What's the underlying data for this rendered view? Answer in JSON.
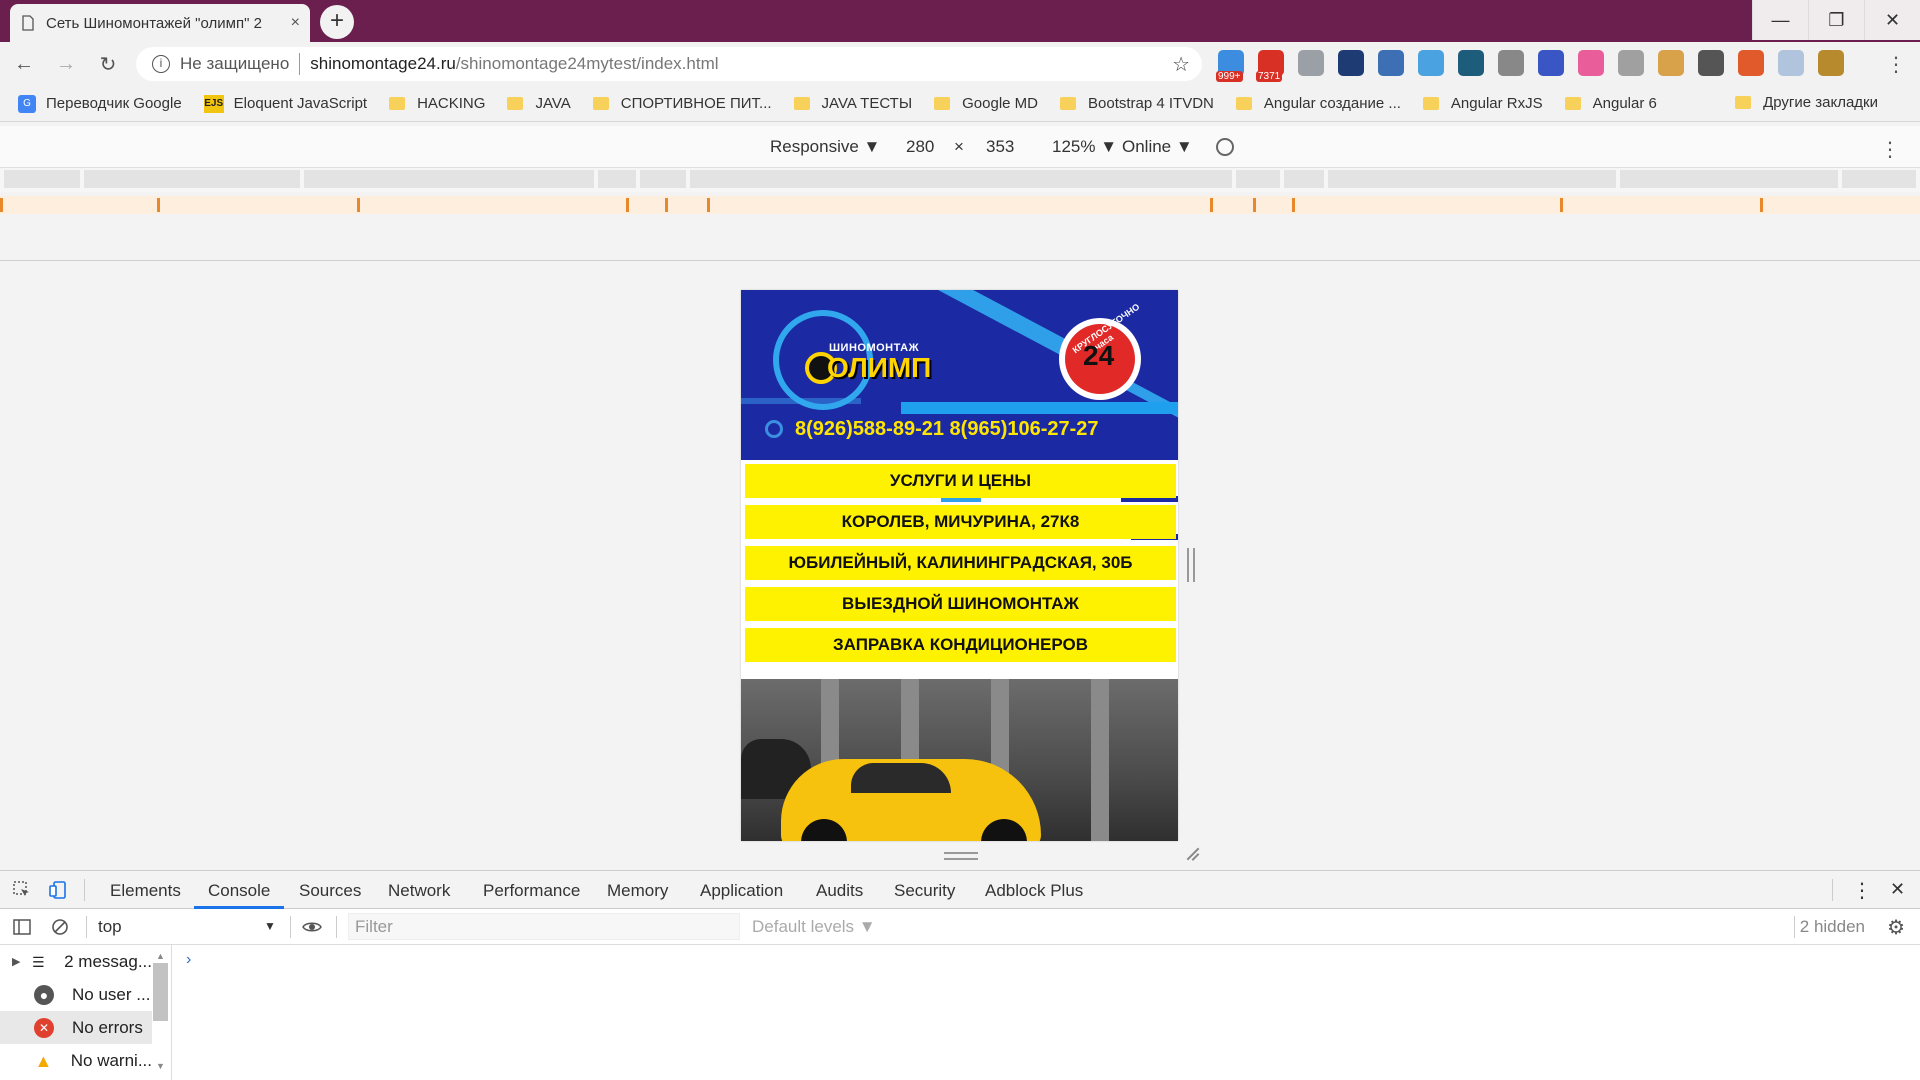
{
  "browser": {
    "tab_title": "Сеть Шиномонтажей \"олимп\" 2",
    "tab_close": "×",
    "new_tab": "+",
    "window": {
      "minimize": "—",
      "restore": "❐",
      "close": "✕"
    },
    "nav": {
      "back": "←",
      "forward": "→",
      "reload": "↻"
    },
    "address": {
      "security_label": "Не защищено",
      "host": "shinomontage24.ru",
      "path": "/shinomontage24mytest/index.html",
      "star": "☆"
    },
    "extensions": [
      {
        "name": "ext-1",
        "color": "#3c8de0",
        "badge": "999+"
      },
      {
        "name": "ext-gmail",
        "color": "#d93025",
        "badge": "7371"
      },
      {
        "name": "ext-music",
        "color": "#9aa0a6",
        "badge": ""
      },
      {
        "name": "ext-drive",
        "color": "#1f3b73",
        "badge": ""
      },
      {
        "name": "ext-wordpress",
        "color": "#3c6fb4",
        "badge": ""
      },
      {
        "name": "ext-search",
        "color": "#4aa3e0",
        "badge": ""
      },
      {
        "name": "ext-w",
        "color": "#1d5c7b",
        "badge": ""
      },
      {
        "name": "ext-gear",
        "color": "#888888",
        "badge": ""
      },
      {
        "name": "ext-crop",
        "color": "#3a55c4",
        "badge": ""
      },
      {
        "name": "ext-gradient",
        "color": "#e85d9a",
        "badge": ""
      },
      {
        "name": "ext-circle",
        "color": "#a0a0a0",
        "badge": ""
      },
      {
        "name": "ext-palette",
        "color": "#d8a24a",
        "badge": ""
      },
      {
        "name": "ext-download",
        "color": "#555555",
        "badge": ""
      },
      {
        "name": "ext-chrome",
        "color": "#e05a2b",
        "badge": ""
      },
      {
        "name": "ext-puzzle",
        "color": "#b0c4de",
        "badge": ""
      },
      {
        "name": "ext-avatar",
        "color": "#b88a2e",
        "badge": ""
      }
    ],
    "menu": "⋮",
    "bookmarks": [
      {
        "label": "Переводчик Google",
        "icon": "google-translate-icon"
      },
      {
        "label": "Eloquent JavaScript",
        "icon": "ejs-icon"
      },
      {
        "label": "HACKING",
        "icon": "folder-icon"
      },
      {
        "label": "JAVA",
        "icon": "folder-icon"
      },
      {
        "label": "СПОРТИВНОЕ ПИТ...",
        "icon": "folder-icon"
      },
      {
        "label": "JAVA ТЕСТЫ",
        "icon": "folder-icon"
      },
      {
        "label": "Google MD",
        "icon": "folder-icon"
      },
      {
        "label": "Bootstrap 4 ITVDN",
        "icon": "folder-icon"
      },
      {
        "label": "Angular создание ...",
        "icon": "folder-icon"
      },
      {
        "label": "Angular RxJS",
        "icon": "folder-icon"
      },
      {
        "label": "Angular 6",
        "icon": "folder-icon"
      }
    ],
    "bookmarks_more": "»",
    "bookmarks_other": "Другие закладки"
  },
  "device_toolbar": {
    "device": "Responsive ▼",
    "width": "280",
    "times": "×",
    "height": "353",
    "zoom": "125% ▼",
    "throttle": "Online ▼",
    "menu": "⋮"
  },
  "site": {
    "logo_top": "ШИНОМОНТАЖ",
    "logo_main": "ОЛИМП",
    "sticker_number": "24",
    "sticker_text": "КРУГЛОСУТОЧНО часа",
    "phones": "8(926)588-89-21 8(965)106-27-27",
    "menu": [
      "УСЛУГИ И ЦЕНЫ",
      "КОРОЛЕВ, МИЧУРИНА, 27К8",
      "ЮБИЛЕЙНЫЙ, КАЛИНИНГРАДСКАЯ, 30Б",
      "ВЫЕЗДНОЙ ШИНОМОНТАЖ",
      "ЗАПРАВКА КОНДИЦИОНЕРОВ"
    ]
  },
  "devtools": {
    "tabs": [
      "Elements",
      "Console",
      "Sources",
      "Network",
      "Performance",
      "Memory",
      "Application",
      "Audits",
      "Security",
      "Adblock Plus"
    ],
    "active_tab": "Console",
    "context": "top",
    "filter_placeholder": "Filter",
    "levels": "Default levels ▼",
    "hidden": "2 hidden",
    "settings": "⚙",
    "sidebar": [
      {
        "label": "2 messag...",
        "icon": "list-icon"
      },
      {
        "label": "No user ...",
        "icon": "user-icon"
      },
      {
        "label": "No errors",
        "icon": "error-icon"
      },
      {
        "label": "No warni...",
        "icon": "warning-icon"
      }
    ],
    "prompt": "›",
    "close": "✕",
    "menu": "⋮"
  }
}
